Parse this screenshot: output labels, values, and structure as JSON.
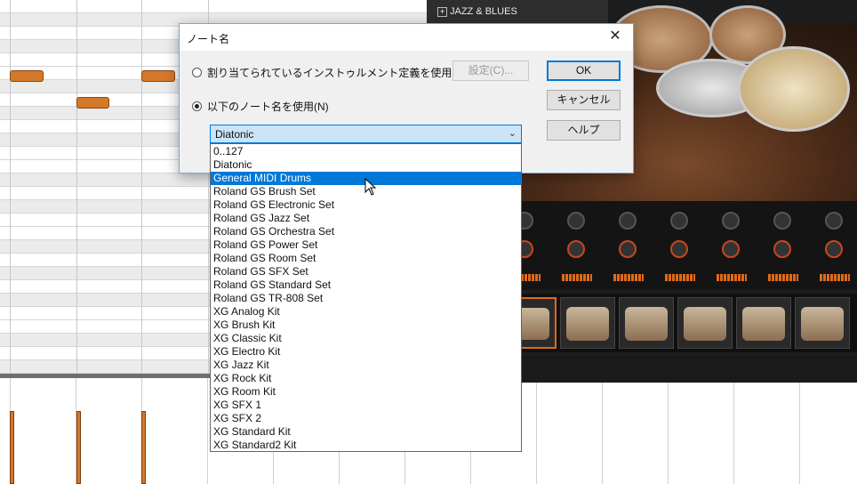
{
  "plugin": {
    "kit_group": "JAZZ & BLUES"
  },
  "dialog": {
    "title": "ノート名",
    "close_glyph": "✕",
    "option_instrument": "割り当てられているインストゥルメント定義を使用(U)",
    "option_note_names": "以下のノート名を使用(N)",
    "selected_option": "option_note_names",
    "settings_button": "設定(C)...",
    "ok_button": "OK",
    "cancel_button": "キャンセル",
    "help_button": "ヘルプ"
  },
  "combo": {
    "value": "Diatonic",
    "chevron": "⌄"
  },
  "dropdown": {
    "highlighted_index": 2,
    "items": [
      "0..127",
      "Diatonic",
      "General MIDI Drums",
      "Roland GS Brush Set",
      "Roland GS Electronic Set",
      "Roland GS Jazz Set",
      "Roland GS Orchestra Set",
      "Roland GS Power Set",
      "Roland GS Room Set",
      "Roland GS SFX Set",
      "Roland GS Standard Set",
      "Roland GS TR-808 Set",
      "XG Analog Kit",
      "XG Brush Kit",
      "XG Classic Kit",
      "XG Electro Kit",
      "XG Jazz Kit",
      "XG Rock Kit",
      "XG Room Kit",
      "XG SFX 1",
      "XG SFX 2",
      "XG Standard Kit",
      "XG Standard2 Kit"
    ]
  },
  "colors": {
    "accent": "#0078d7",
    "note": "#d4782a",
    "meter": "#e06a1a"
  },
  "icons": {
    "expand": "plus-box-icon",
    "close": "close-icon",
    "chevron": "chevron-down-icon",
    "cursor": "mouse-pointer-icon"
  }
}
